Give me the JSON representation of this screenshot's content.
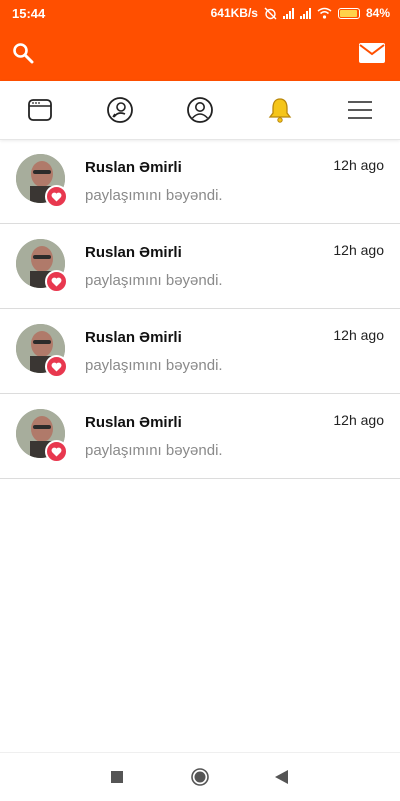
{
  "status_bar": {
    "time": "15:44",
    "net_speed": "641KB/s",
    "battery": "84%",
    "battery_level": 0.84
  },
  "header": {
    "search_icon": "search-icon",
    "mail_icon": "mail-icon",
    "color": "#ff4f00"
  },
  "tabs": [
    {
      "icon": "feed-icon"
    },
    {
      "icon": "find-people-icon"
    },
    {
      "icon": "profile-icon"
    },
    {
      "icon": "bell-icon",
      "active": true
    },
    {
      "icon": "menu-icon"
    }
  ],
  "notifications": [
    {
      "name": "Ruslan Əmirli",
      "action": "paylaşımını bəyəndi.",
      "time": "12h ago",
      "badge": "heart-icon"
    },
    {
      "name": "Ruslan Əmirli",
      "action": "paylaşımını bəyəndi.",
      "time": "12h ago",
      "badge": "heart-icon"
    },
    {
      "name": "Ruslan Əmirli",
      "action": "paylaşımını bəyəndi.",
      "time": "12h ago",
      "badge": "heart-icon"
    },
    {
      "name": "Ruslan Əmirli",
      "action": "paylaşımını bəyəndi.",
      "time": "12h ago",
      "badge": "heart-icon"
    }
  ],
  "colors": {
    "accent": "#ff4f00",
    "like_badge": "#e8384f",
    "bell": "#f5c518"
  }
}
